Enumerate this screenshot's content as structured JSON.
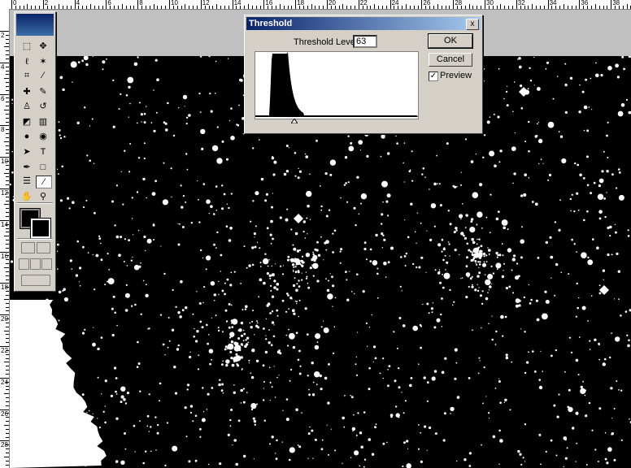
{
  "dialog": {
    "title": "Threshold",
    "close_label": "x",
    "level_label": "Threshold Level:",
    "level_value": "63",
    "ok_label": "OK",
    "cancel_label": "Cancel",
    "preview_label": "Preview",
    "preview_checked": true,
    "checkmark": "✓"
  },
  "ruler": {
    "top_labels": [
      "0",
      "2",
      "4",
      "6",
      "8",
      "10",
      "12",
      "14",
      "16",
      "18",
      "20",
      "22",
      "24",
      "26",
      "28",
      "30",
      "32",
      "34",
      "36",
      "38"
    ],
    "left_labels": [
      "2",
      "4",
      "6",
      "8",
      "10",
      "12",
      "14",
      "16",
      "18",
      "20",
      "22",
      "24",
      "26",
      "28"
    ]
  },
  "toolbox": {
    "tools": [
      {
        "name": "marquee-tool-icon",
        "glyph": "⬚"
      },
      {
        "name": "move-tool-icon",
        "glyph": "✥"
      },
      {
        "name": "lasso-tool-icon",
        "glyph": "ℓ"
      },
      {
        "name": "magic-wand-tool-icon",
        "glyph": "✶"
      },
      {
        "name": "crop-tool-icon",
        "glyph": "⌗"
      },
      {
        "name": "slice-tool-icon",
        "glyph": "∕"
      },
      {
        "name": "healing-brush-tool-icon",
        "glyph": "✚"
      },
      {
        "name": "brush-tool-icon",
        "glyph": "✎"
      },
      {
        "name": "clone-stamp-tool-icon",
        "glyph": "♙"
      },
      {
        "name": "history-brush-tool-icon",
        "glyph": "↺"
      },
      {
        "name": "eraser-tool-icon",
        "glyph": "◩"
      },
      {
        "name": "gradient-tool-icon",
        "glyph": "▥"
      },
      {
        "name": "blur-tool-icon",
        "glyph": "●"
      },
      {
        "name": "dodge-tool-icon",
        "glyph": "◉"
      },
      {
        "name": "path-selection-tool-icon",
        "glyph": "➤"
      },
      {
        "name": "type-tool-icon",
        "glyph": "T"
      },
      {
        "name": "pen-tool-icon",
        "glyph": "✒"
      },
      {
        "name": "shape-tool-icon",
        "glyph": "□"
      },
      {
        "name": "notes-tool-icon",
        "glyph": "☰"
      },
      {
        "name": "eyedropper-tool-icon",
        "glyph": "⁄"
      },
      {
        "name": "hand-tool-icon",
        "glyph": "✋"
      },
      {
        "name": "zoom-tool-icon",
        "glyph": "⚲"
      }
    ],
    "active_index": 19
  },
  "colors": {
    "canvas": "#000000",
    "stars": "#ffffff",
    "dialog": "#d4d0c8",
    "titlebar": "#0a246a"
  }
}
